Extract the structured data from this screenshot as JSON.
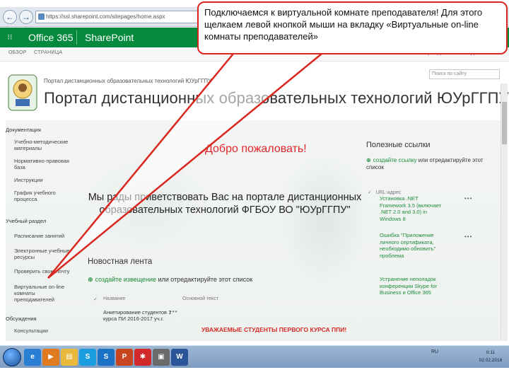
{
  "browser": {
    "back_glyph": "←",
    "forward_glyph": "→",
    "address_fragment": "https://ssl.sharepoint.com/sitepages/home.aspx",
    "tab_icons": [
      "s",
      "o"
    ]
  },
  "suite_bar": {
    "waffle_icon": "waffle-icon",
    "waffle_glyph": "⁝⁝",
    "product": "Office 365",
    "app": "SharePoint"
  },
  "ribbon": {
    "tabs": [
      "ОБЗОР",
      "СТРАНИЦА"
    ],
    "right_actions": [
      "ОБЩИЙ ДОСТУП",
      "СЛЕДИТЬ"
    ]
  },
  "site": {
    "breadcrumb": "Портал дистанционных образовательных технологий ЮУрГГПУ",
    "title": "Портал дистанционных образовательных технологий ЮУрГГПУ",
    "search_placeholder": "Поиск по сайту"
  },
  "left_nav": {
    "sections": [
      {
        "heading": "Документация",
        "items": [
          "Учебно-методические материалы",
          "Нормативно-правовая база",
          "Инструкции",
          "График учебного процесса"
        ]
      },
      {
        "heading": "Учебный раздел",
        "items": [
          "Расписание занятий",
          "Электронные учебные ресурсы",
          "Проверить свою почту",
          "Виртуальные on-line комнаты преподавателей"
        ]
      },
      {
        "heading": "Обсуждения",
        "items": [
          "Консультации"
        ]
      }
    ]
  },
  "center": {
    "welcome": "Добро пожаловать!",
    "greeting": "Мы рады приветствовать Вас на портале дистанционных образовательных технологий ФГБОУ ВО \"ЮУрГГПУ\"",
    "news_title": "Новостная лента",
    "news_add_plus": "⊕",
    "news_add_link": "создайте извещение",
    "news_add_rest": " или отредактируйте этот список",
    "news_headers": [
      "Название",
      "Основной текст"
    ],
    "news_row": "Анкетирование студентов 1 курса ПИ 2016-2017 уч.г.",
    "announce": "УВАЖАЕМЫЕ СТУДЕНТЫ ПЕРВОГО КУРСА ППИ!"
  },
  "links": {
    "title": "Полезные ссылки",
    "add_plus": "⊕",
    "add_link": "создайте ссылку",
    "add_rest": " или отредактируйте этот список",
    "header": "URL-адрес",
    "items": [
      "Установка .NET Framework 3.5 (включает .NET 2.0 and 3.0) in Windows 8",
      "Ошибка \"Приложение личного сертификата, необходимо обновить\" проблема",
      "Устранение неполадок конференции Skype for Business и Office 365"
    ]
  },
  "callout": {
    "text": "Подключаемся к виртуальной комнате преподавателя! Для этого щелкаем левой кнопкой мыши на вкладку «Виртуальные on-line комнаты преподавателей»",
    "border_color": "#d9261f"
  },
  "taskbar": {
    "icons": [
      {
        "name": "ie-icon",
        "glyph": "e",
        "color": "#2a7fd4"
      },
      {
        "name": "media-player-icon",
        "glyph": "▶",
        "color": "#e07a1e"
      },
      {
        "name": "explorer-icon",
        "glyph": "▤",
        "color": "#e8b93a"
      },
      {
        "name": "skype-icon",
        "glyph": "S",
        "color": "#1b9be0"
      },
      {
        "name": "skype-business-icon",
        "glyph": "S",
        "color": "#1b72c7"
      },
      {
        "name": "powerpoint-icon",
        "glyph": "P",
        "color": "#c9451f"
      },
      {
        "name": "paint-icon",
        "glyph": "✱",
        "color": "#d22a2a"
      },
      {
        "name": "photo-icon",
        "glyph": "▣",
        "color": "#6a6a6a"
      },
      {
        "name": "word-icon",
        "glyph": "W",
        "color": "#2a5699"
      }
    ],
    "tray_lang": "RU",
    "clock_time": "9:11",
    "clock_date": "02.02.2018"
  },
  "colors": {
    "accent_green": "#058a3d",
    "link_green": "#1c8b3a",
    "welcome_red": "#e2262b"
  }
}
